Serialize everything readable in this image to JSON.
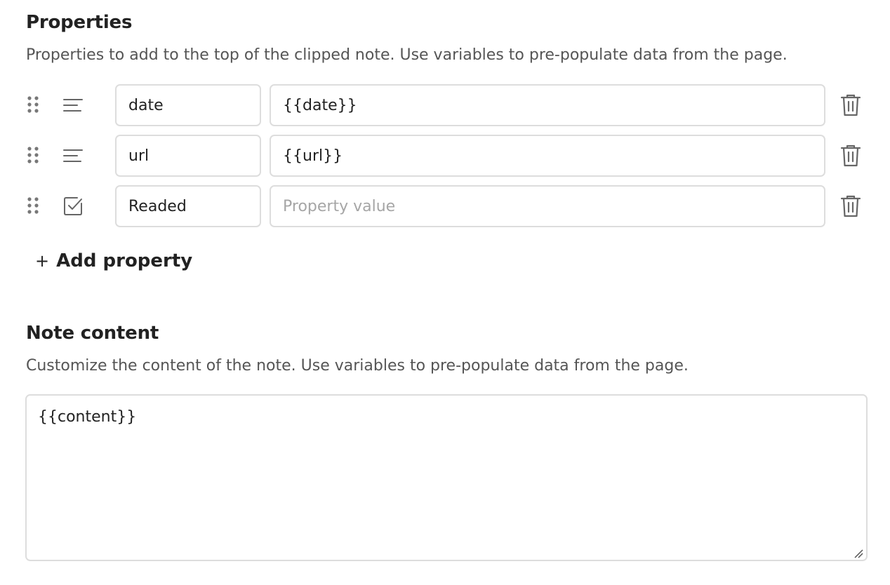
{
  "properties_section": {
    "title": "Properties",
    "description": "Properties to add to the top of the clipped note. Use variables to pre-populate data from the page.",
    "rows": [
      {
        "type_icon": "text-lines-icon",
        "name": "date",
        "value": "{{date}}",
        "value_placeholder": "Property value"
      },
      {
        "type_icon": "text-lines-icon",
        "name": "url",
        "value": "{{url}}",
        "value_placeholder": "Property value"
      },
      {
        "type_icon": "checkbox-icon",
        "name": "Readed",
        "value": "",
        "value_placeholder": "Property value"
      }
    ],
    "add_button": {
      "plus": "+",
      "label": "Add property"
    }
  },
  "note_content_section": {
    "title": "Note content",
    "description": "Customize the content of the note. Use variables to pre-populate data from the page.",
    "value": "{{content}}"
  },
  "colors": {
    "text": "#222222",
    "muted_text": "#555555",
    "placeholder": "#a6a6a6",
    "border": "#dddddd",
    "icon": "#666666",
    "background": "#ffffff"
  }
}
